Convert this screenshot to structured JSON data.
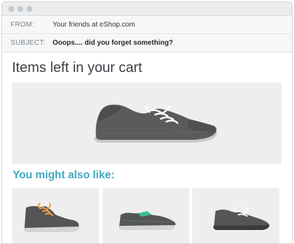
{
  "email": {
    "from_label": "FROM:",
    "from_value": "Your friends at eShop.com",
    "subject_label": "SUBJECT:",
    "subject_value": "Ooops.... did you forget something?"
  },
  "cart": {
    "title": "Items left in your cart"
  },
  "recommendations": {
    "title": "You might also like:",
    "accent_colors": [
      "#f0a13a",
      "#3cc28a",
      "#ffffff"
    ]
  },
  "colors": {
    "accent": "#3fa7c2",
    "shoe": "#5a5b5d",
    "sole": "#d9d9d9"
  }
}
